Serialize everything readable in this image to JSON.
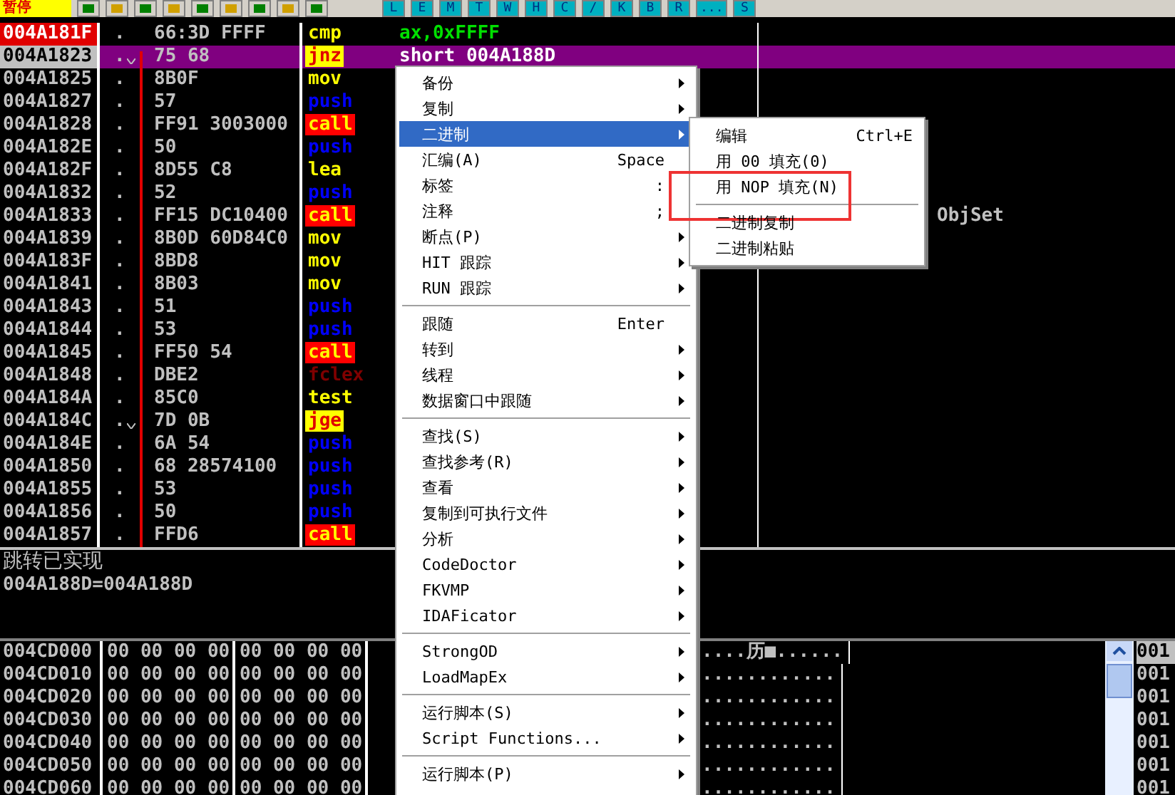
{
  "toolbar": {
    "status": "暂停",
    "letters": [
      "L",
      "E",
      "M",
      "T",
      "W",
      "H",
      "C",
      "/",
      "K",
      "B",
      "R",
      "...",
      "S"
    ]
  },
  "disasm": {
    "rows": [
      {
        "address": "004A181F",
        "marker": ".",
        "jump": false,
        "hex": "66:3D FFFF",
        "mnemonic": "cmp",
        "kind": "plain",
        "operand": "ax,0xFFFF",
        "current": true,
        "selected": false
      },
      {
        "address": "004A1823",
        "marker": ".",
        "jump": true,
        "hex": "75 68",
        "mnemonic": "jnz",
        "kind": "jump",
        "operand": "short 004A188D",
        "current": false,
        "selected": true
      },
      {
        "address": "004A1825",
        "marker": ".",
        "jump": false,
        "hex": "8B0F",
        "mnemonic": "mov",
        "kind": "plain",
        "current": false,
        "selected": false
      },
      {
        "address": "004A1827",
        "marker": ".",
        "jump": false,
        "hex": "57",
        "mnemonic": "push",
        "kind": "push",
        "current": false,
        "selected": false
      },
      {
        "address": "004A1828",
        "marker": ".",
        "jump": false,
        "hex": "FF91 3003000",
        "mnemonic": "call",
        "kind": "call",
        "current": false,
        "selected": false
      },
      {
        "address": "004A182E",
        "marker": ".",
        "jump": false,
        "hex": "50",
        "mnemonic": "push",
        "kind": "push",
        "current": false,
        "selected": false
      },
      {
        "address": "004A182F",
        "marker": ".",
        "jump": false,
        "hex": "8D55 C8",
        "mnemonic": "lea",
        "kind": "plain",
        "current": false,
        "selected": false
      },
      {
        "address": "004A1832",
        "marker": ".",
        "jump": false,
        "hex": "52",
        "mnemonic": "push",
        "kind": "push",
        "current": false,
        "selected": false
      },
      {
        "address": "004A1833",
        "marker": ".",
        "jump": false,
        "hex": "FF15 DC10400",
        "mnemonic": "call",
        "kind": "call",
        "comment": "ObjSet",
        "current": false,
        "selected": false
      },
      {
        "address": "004A1839",
        "marker": ".",
        "jump": false,
        "hex": "8B0D 60D84C0",
        "mnemonic": "mov",
        "kind": "plain",
        "current": false,
        "selected": false
      },
      {
        "address": "004A183F",
        "marker": ".",
        "jump": false,
        "hex": "8BD8",
        "mnemonic": "mov",
        "kind": "plain",
        "current": false,
        "selected": false
      },
      {
        "address": "004A1841",
        "marker": ".",
        "jump": false,
        "hex": "8B03",
        "mnemonic": "mov",
        "kind": "plain",
        "current": false,
        "selected": false
      },
      {
        "address": "004A1843",
        "marker": ".",
        "jump": false,
        "hex": "51",
        "mnemonic": "push",
        "kind": "push",
        "current": false,
        "selected": false
      },
      {
        "address": "004A1844",
        "marker": ".",
        "jump": false,
        "hex": "53",
        "mnemonic": "push",
        "kind": "push",
        "current": false,
        "selected": false
      },
      {
        "address": "004A1845",
        "marker": ".",
        "jump": false,
        "hex": "FF50 54",
        "mnemonic": "call",
        "kind": "call",
        "current": false,
        "selected": false
      },
      {
        "address": "004A1848",
        "marker": ".",
        "jump": false,
        "hex": "DBE2",
        "mnemonic": "fclex",
        "kind": "fpu",
        "current": false,
        "selected": false
      },
      {
        "address": "004A184A",
        "marker": ".",
        "jump": false,
        "hex": "85C0",
        "mnemonic": "test",
        "kind": "plain",
        "current": false,
        "selected": false
      },
      {
        "address": "004A184C",
        "marker": ".",
        "jump": true,
        "hex": "7D 0B",
        "mnemonic": "jge",
        "kind": "jump",
        "current": false,
        "selected": false
      },
      {
        "address": "004A184E",
        "marker": ".",
        "jump": false,
        "hex": "6A 54",
        "mnemonic": "push",
        "kind": "push",
        "current": false,
        "selected": false
      },
      {
        "address": "004A1850",
        "marker": ".",
        "jump": false,
        "hex": "68 28574100",
        "mnemonic": "push",
        "kind": "push",
        "current": false,
        "selected": false
      },
      {
        "address": "004A1855",
        "marker": ".",
        "jump": false,
        "hex": "53",
        "mnemonic": "push",
        "kind": "push",
        "current": false,
        "selected": false
      },
      {
        "address": "004A1856",
        "marker": ".",
        "jump": false,
        "hex": "50",
        "mnemonic": "push",
        "kind": "push",
        "current": false,
        "selected": false
      },
      {
        "address": "004A1857",
        "marker": ".",
        "jump": false,
        "hex": "FFD6",
        "mnemonic": "call",
        "kind": "call",
        "current": false,
        "selected": false
      }
    ]
  },
  "info": [
    "跳转已实现",
    "004A188D=004A188D"
  ],
  "dump": {
    "rows": [
      {
        "address": "004CD000",
        "groups": [
          "00 00 00 00",
          "00 00 00 00"
        ],
        "ascii": "....历■......",
        "stack": "001"
      },
      {
        "address": "004CD010",
        "groups": [
          "00 00 00 00",
          "00 00 00 00"
        ],
        "ascii": "............",
        "stack": "001"
      },
      {
        "address": "004CD020",
        "groups": [
          "00 00 00 00",
          "00 00 00 00"
        ],
        "ascii": "............",
        "stack": "001"
      },
      {
        "address": "004CD030",
        "groups": [
          "00 00 00 00",
          "00 00 00 00"
        ],
        "ascii": "............",
        "stack": "001"
      },
      {
        "address": "004CD040",
        "groups": [
          "00 00 00 00",
          "00 00 00 00"
        ],
        "ascii": "............",
        "stack": "001"
      },
      {
        "address": "004CD050",
        "groups": [
          "00 00 00 00",
          "00 00 00 00"
        ],
        "ascii": "............",
        "stack": "001"
      },
      {
        "address": "004CD060",
        "groups": [
          "00 00 00 00",
          "00 00 00 00"
        ],
        "ascii": "............",
        "stack": "001"
      }
    ]
  },
  "context_menu": {
    "items": [
      {
        "kind": "item",
        "label": "备份",
        "submenu": true,
        "selected": false
      },
      {
        "kind": "item",
        "label": "复制",
        "submenu": true,
        "selected": false
      },
      {
        "kind": "item",
        "label": "二进制",
        "submenu": true,
        "selected": true
      },
      {
        "kind": "item",
        "label": "汇编(A)",
        "shortcut": "Space",
        "submenu": false,
        "selected": false
      },
      {
        "kind": "item",
        "label": "标签",
        "shortcut": ":",
        "submenu": false,
        "selected": false
      },
      {
        "kind": "item",
        "label": "注释",
        "shortcut": ";",
        "submenu": false,
        "selected": false
      },
      {
        "kind": "item",
        "label": "断点(P)",
        "submenu": true,
        "selected": false
      },
      {
        "kind": "item",
        "label": "HIT 跟踪",
        "submenu": true,
        "selected": false
      },
      {
        "kind": "item",
        "label": "RUN 跟踪",
        "submenu": true,
        "selected": false
      },
      {
        "kind": "separator"
      },
      {
        "kind": "item",
        "label": "跟随",
        "shortcut": "Enter",
        "submenu": false,
        "selected": false
      },
      {
        "kind": "item",
        "label": "转到",
        "submenu": true,
        "selected": false
      },
      {
        "kind": "item",
        "label": "线程",
        "submenu": true,
        "selected": false
      },
      {
        "kind": "item",
        "label": "数据窗口中跟随",
        "submenu": true,
        "selected": false
      },
      {
        "kind": "separator"
      },
      {
        "kind": "item",
        "label": "查找(S)",
        "submenu": true,
        "selected": false
      },
      {
        "kind": "item",
        "label": "查找参考(R)",
        "submenu": true,
        "selected": false
      },
      {
        "kind": "item",
        "label": "查看",
        "submenu": true,
        "selected": false
      },
      {
        "kind": "item",
        "label": "复制到可执行文件",
        "submenu": true,
        "selected": false
      },
      {
        "kind": "item",
        "label": "分析",
        "submenu": true,
        "selected": false
      },
      {
        "kind": "item",
        "label": "CodeDoctor",
        "submenu": true,
        "selected": false
      },
      {
        "kind": "item",
        "label": "FKVMP",
        "submenu": true,
        "selected": false
      },
      {
        "kind": "item",
        "label": "IDAFicator",
        "submenu": true,
        "selected": false
      },
      {
        "kind": "separator"
      },
      {
        "kind": "item",
        "label": "StrongOD",
        "submenu": true,
        "selected": false
      },
      {
        "kind": "item",
        "label": "LoadMapEx",
        "submenu": true,
        "selected": false
      },
      {
        "kind": "separator"
      },
      {
        "kind": "item",
        "label": "运行脚本(S)",
        "submenu": true,
        "selected": false
      },
      {
        "kind": "item",
        "label": "Script Functions...",
        "submenu": true,
        "selected": false
      },
      {
        "kind": "separator"
      },
      {
        "kind": "item",
        "label": "运行脚本(P)",
        "submenu": true,
        "selected": false
      }
    ]
  },
  "submenu": {
    "items": [
      {
        "kind": "item",
        "label": "编辑",
        "shortcut": "Ctrl+E",
        "highlighted": false
      },
      {
        "kind": "item",
        "label": "用 00 填充(0)",
        "highlighted": false
      },
      {
        "kind": "item",
        "label": "用 NOP 填充(N)",
        "highlighted": true
      },
      {
        "kind": "separator"
      },
      {
        "kind": "item",
        "label": "二进制复制",
        "highlighted": false
      },
      {
        "kind": "item",
        "label": "二进制粘贴",
        "highlighted": false
      }
    ]
  }
}
